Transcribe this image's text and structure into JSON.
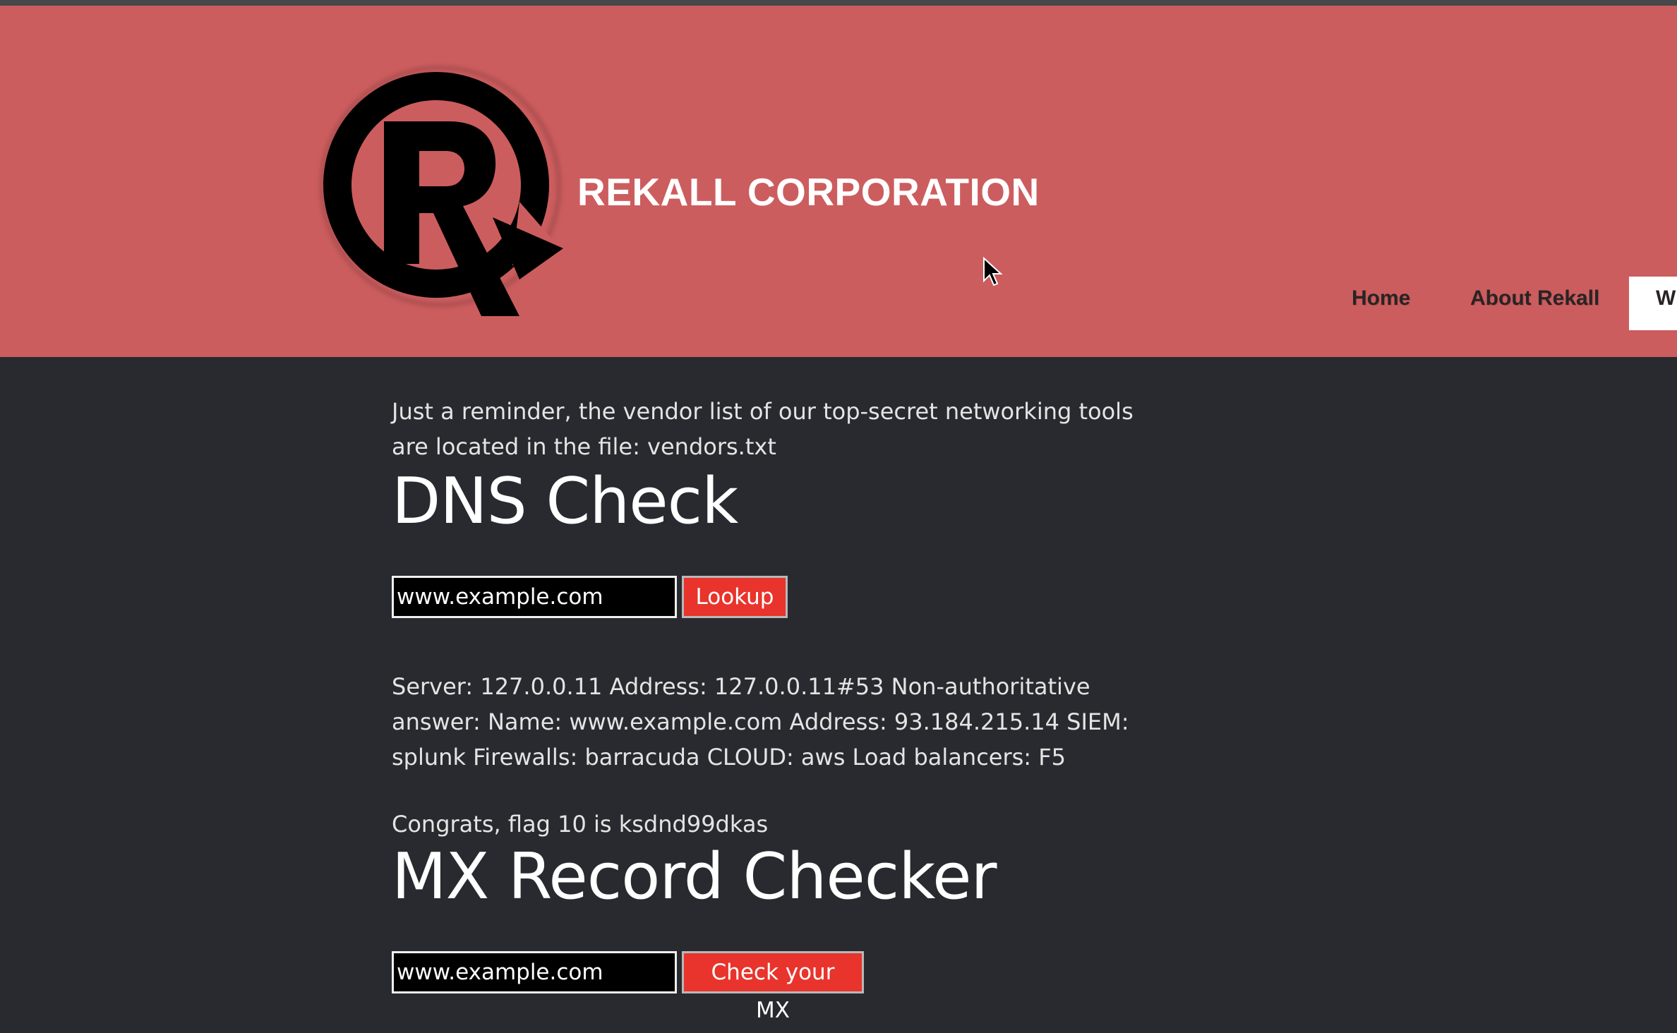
{
  "header": {
    "brand": "REKALL CORPORATION",
    "logo_icon": "rekall-r-logo",
    "colors": {
      "background": "#cc5d5e",
      "text": "#ffffff"
    }
  },
  "nav": {
    "items": [
      {
        "label": "Home"
      },
      {
        "label": "About Rekall"
      },
      {
        "label": "W"
      }
    ]
  },
  "main": {
    "reminder": "Just a reminder, the vendor list of our top-secret networking tools are located in the file: vendors.txt",
    "dns": {
      "title": "DNS Check",
      "input_value": "www.example.com",
      "button_label": "Lookup",
      "result": "Server: 127.0.0.11 Address: 127.0.0.11#53 Non-authoritative answer: Name: www.example.com Address: 93.184.215.14 SIEM: splunk Firewalls: barracuda CLOUD: aws Load balancers: F5",
      "flag": "Congrats, flag 10 is ksdnd99dkas"
    },
    "mx": {
      "title": "MX Record Checker",
      "input_value": "www.example.com",
      "button_label": "Check your MX"
    },
    "colors": {
      "background": "#282a2f",
      "button": "#e8342c"
    }
  }
}
